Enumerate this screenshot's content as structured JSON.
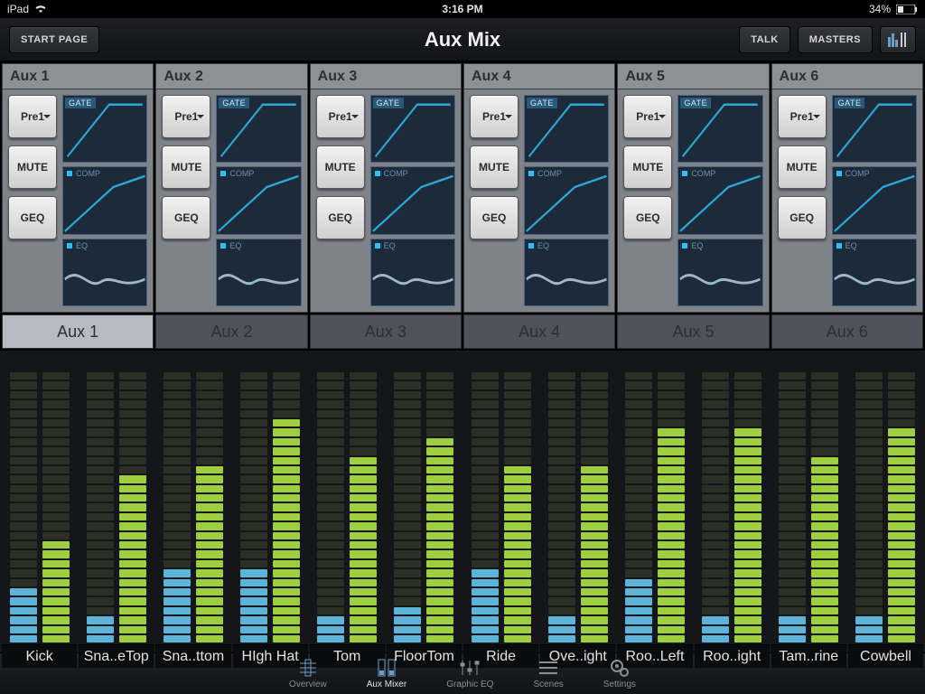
{
  "status": {
    "device": "iPad",
    "time": "3:16 PM",
    "battery": "34%"
  },
  "header": {
    "start_page": "START PAGE",
    "title": "Aux Mix",
    "talk": "TALK",
    "masters": "MASTERS"
  },
  "aux": {
    "strips": [
      {
        "title": "Aux 1",
        "pre": "Pre1",
        "mute": "MUTE",
        "geq": "GEQ",
        "gate": "GATE",
        "comp": "COMP",
        "eq": "EQ"
      },
      {
        "title": "Aux 2",
        "pre": "Pre1",
        "mute": "MUTE",
        "geq": "GEQ",
        "gate": "GATE",
        "comp": "COMP",
        "eq": "EQ"
      },
      {
        "title": "Aux 3",
        "pre": "Pre1",
        "mute": "MUTE",
        "geq": "GEQ",
        "gate": "GATE",
        "comp": "COMP",
        "eq": "EQ"
      },
      {
        "title": "Aux 4",
        "pre": "Pre1",
        "mute": "MUTE",
        "geq": "GEQ",
        "gate": "GATE",
        "comp": "COMP",
        "eq": "EQ"
      },
      {
        "title": "Aux 5",
        "pre": "Pre1",
        "mute": "MUTE",
        "geq": "GEQ",
        "gate": "GATE",
        "comp": "COMP",
        "eq": "EQ"
      },
      {
        "title": "Aux 6",
        "pre": "Pre1",
        "mute": "MUTE",
        "geq": "GEQ",
        "gate": "GATE",
        "comp": "COMP",
        "eq": "EQ"
      }
    ],
    "tabs": [
      "Aux 1",
      "Aux 2",
      "Aux 3",
      "Aux 4",
      "Aux 5",
      "Aux 6"
    ]
  },
  "channels": [
    {
      "name": "Kick",
      "main": 11,
      "sub": 6
    },
    {
      "name": "Sna..eTop",
      "main": 18,
      "sub": 3
    },
    {
      "name": "Sna..ttom",
      "main": 19,
      "sub": 8
    },
    {
      "name": "HIgh Hat",
      "main": 24,
      "sub": 8
    },
    {
      "name": "Tom",
      "main": 20,
      "sub": 3
    },
    {
      "name": "FloorTom",
      "main": 22,
      "sub": 4
    },
    {
      "name": "Ride",
      "main": 19,
      "sub": 8
    },
    {
      "name": "Ove..ight",
      "main": 19,
      "sub": 3
    },
    {
      "name": "Roo..Left",
      "main": 23,
      "sub": 7
    },
    {
      "name": "Roo..ight",
      "main": 23,
      "sub": 3
    },
    {
      "name": "Tam..rine",
      "main": 20,
      "sub": 3
    },
    {
      "name": "Cowbell",
      "main": 23,
      "sub": 3
    }
  ],
  "tabs": {
    "overview": "Overview",
    "auxmixer": "Aux Mixer",
    "geq": "Graphic EQ",
    "scenes": "Scenes",
    "settings": "Settings"
  },
  "meter": {
    "total_segments": 29
  }
}
